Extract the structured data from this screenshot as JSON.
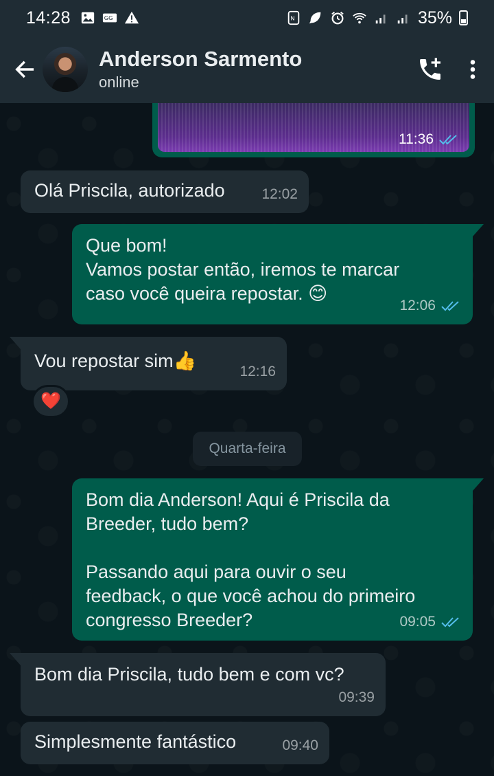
{
  "status_bar": {
    "time": "14:28",
    "battery": "35%",
    "left_icons": [
      "image-icon",
      "dialer-icon",
      "warning-icon"
    ],
    "right_icons": [
      "nfc-icon",
      "leaf-icon",
      "alarm-icon",
      "wifi-icon",
      "signal-icon",
      "signal-icon",
      "battery-icon"
    ]
  },
  "header": {
    "contact_name": "Anderson Sarmento",
    "contact_status": "online",
    "icons": [
      "back-arrow-icon",
      "add-call-icon",
      "more-vertical-icon"
    ]
  },
  "messages": [
    {
      "direction": "out",
      "type": "media",
      "time": "11:36",
      "read": true
    },
    {
      "direction": "in",
      "text": "Olá Priscila, autorizado",
      "time": "12:02"
    },
    {
      "direction": "out",
      "text": "Que bom!\nVamos postar então, iremos te marcar\ncaso você queira repostar. 😊",
      "time": "12:06",
      "read": true
    },
    {
      "direction": "in",
      "text": "Vou repostar sim👍",
      "time": "12:16",
      "reaction": "❤️"
    },
    {
      "direction": "out",
      "text": "Bom dia Anderson! Aqui é Priscila da\nBreeder, tudo bem?\n\nPassando aqui para ouvir o seu\nfeedback, o que você achou do primeiro\ncongresso Breeder?",
      "time": "09:05",
      "read": true
    },
    {
      "direction": "in",
      "text": "Bom dia Priscila, tudo bem e com vc?",
      "time": "09:39"
    },
    {
      "direction": "in",
      "text": "Simplesmente fantástico",
      "time": "09:40"
    }
  ],
  "date_divider": "Quarta-feira",
  "colors": {
    "background": "#0b141a",
    "header": "#1f2c34",
    "incoming_bubble": "#202c33",
    "outgoing_bubble": "#005c4b",
    "read_ticks": "#53bdeb"
  }
}
